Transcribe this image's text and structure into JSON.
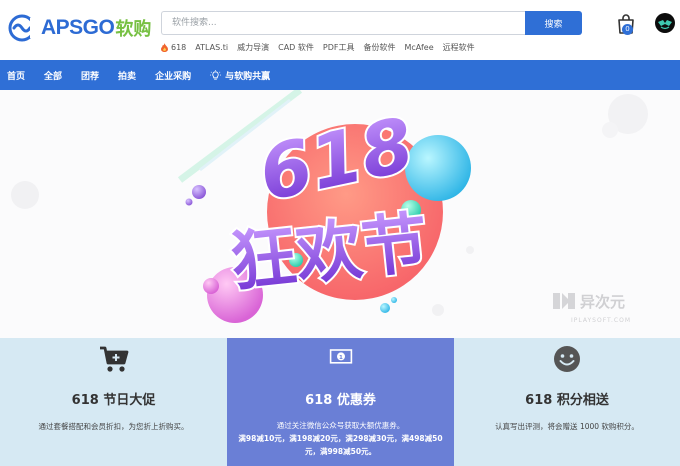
{
  "brand": {
    "logo_text": "APSGO",
    "logo_cn": "软购"
  },
  "search": {
    "placeholder": "软件搜索...",
    "button_label": "搜索"
  },
  "hot_keywords": [
    "618",
    "ATLAS.ti",
    "威力导演",
    "CAD 软件",
    "PDF工具",
    "备份软件",
    "McAfee",
    "远程软件"
  ],
  "cart": {
    "count": "0"
  },
  "nav": {
    "items": [
      "首页",
      "全部",
      "团荐",
      "拍卖",
      "企业采购",
      "与软购共赢"
    ]
  },
  "banner": {
    "headline_top": "618",
    "headline_bottom": "狂欢节",
    "watermark_cn": "异次元",
    "watermark_en": "IPLAYSOFT.COM"
  },
  "promos": [
    {
      "title": "618 节日大促",
      "desc": "通过套餐搭配和会员折扣，为您折上折购买。"
    },
    {
      "title": "618 优惠券",
      "desc": "通过关注微信公众号获取大额优惠券。",
      "desc_strong": "满98减10元，满198减20元，满298减30元，满498减50元，满998减50元。"
    },
    {
      "title": "618 积分相送",
      "desc": "认真写出评测，将会赠送 1000 软购积分。"
    }
  ],
  "colors": {
    "primary": "#2f6fd6",
    "brand_green": "#77c043",
    "promo_light": "#d6e9f3",
    "promo_accent": "#6a7fd6"
  }
}
